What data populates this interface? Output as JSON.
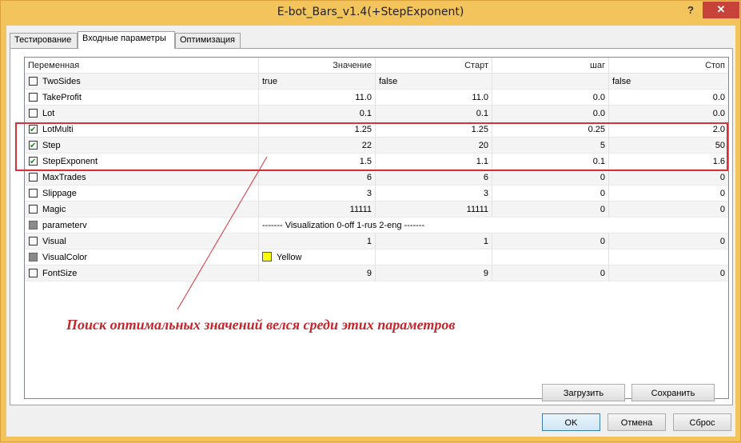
{
  "window": {
    "title": "E-bot_Bars_v1.4(+StepExponent)",
    "help_label": "?",
    "close_label": "✕"
  },
  "tabs": [
    {
      "label": "Тестирование"
    },
    {
      "label": "Входные параметры"
    },
    {
      "label": "Оптимизация"
    }
  ],
  "table": {
    "headers": [
      "Переменная",
      "Значение",
      "Старт",
      "шаг",
      "Стоп"
    ],
    "rows": [
      {
        "name": "TwoSides",
        "checked": false,
        "value": "true",
        "start": "false",
        "step": "",
        "stop": "false"
      },
      {
        "name": "TakeProfit",
        "checked": false,
        "value": "11.0",
        "start": "11.0",
        "step": "0.0",
        "stop": "0.0"
      },
      {
        "name": "Lot",
        "checked": false,
        "value": "0.1",
        "start": "0.1",
        "step": "0.0",
        "stop": "0.0"
      },
      {
        "name": "LotMulti",
        "checked": true,
        "value": "1.25",
        "start": "1.25",
        "step": "0.25",
        "stop": "2.0"
      },
      {
        "name": "Step",
        "checked": true,
        "value": "22",
        "start": "20",
        "step": "5",
        "stop": "50"
      },
      {
        "name": "StepExponent",
        "checked": true,
        "value": "1.5",
        "start": "1.1",
        "step": "0.1",
        "stop": "1.6"
      },
      {
        "name": "MaxTrades",
        "checked": false,
        "value": "6",
        "start": "6",
        "step": "0",
        "stop": "0"
      },
      {
        "name": "Slippage",
        "checked": false,
        "value": "3",
        "start": "3",
        "step": "0",
        "stop": "0"
      },
      {
        "name": "Magic",
        "checked": false,
        "value": "11111",
        "start": "11111",
        "step": "0",
        "stop": "0"
      },
      {
        "name": "parameterv",
        "checked": false,
        "value": "------- Visualization    0-off  1-rus  2-eng -------",
        "start": "",
        "step": "",
        "stop": ""
      },
      {
        "name": "Visual",
        "checked": false,
        "value": "1",
        "start": "1",
        "step": "0",
        "stop": "0"
      },
      {
        "name": "VisualColor",
        "checked": false,
        "value": "Yellow",
        "start": "",
        "step": "",
        "stop": ""
      },
      {
        "name": "FontSize",
        "checked": false,
        "value": "9",
        "start": "9",
        "step": "0",
        "stop": "0"
      }
    ]
  },
  "annotation": {
    "text": "Поиск оптимальных значений велся среди этих параметров",
    "color": "#c4262e"
  },
  "buttons": {
    "load": "Загрузить",
    "save": "Сохранить",
    "ok": "OK",
    "cancel": "Отмена",
    "reset": "Сброс"
  },
  "colors": {
    "highlight_box": "#d6303a",
    "visual_color_swatch": "#ffff00",
    "check_mark": "#1b8a1b"
  }
}
